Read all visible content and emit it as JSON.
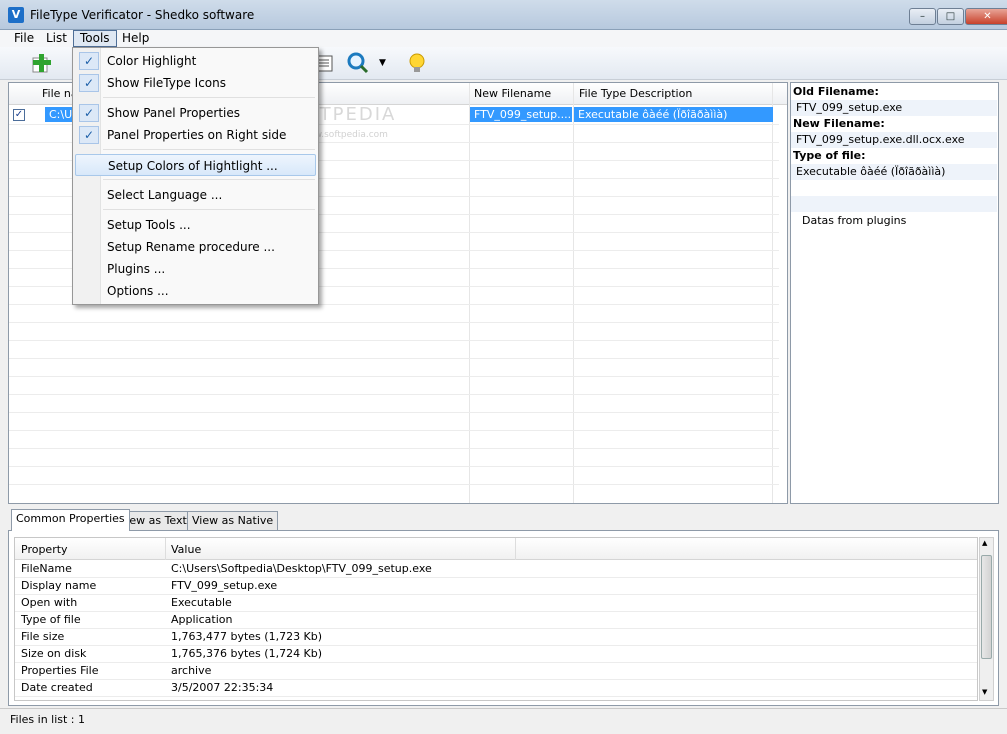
{
  "window": {
    "title": "FileType Verificator - Shedko software",
    "minimize": "–",
    "maximize": "□",
    "close": "✕"
  },
  "menu": [
    "File",
    "List",
    "Tools",
    "Help"
  ],
  "toolbar_icons": [
    "add-files-icon",
    "list-view-icon",
    "search-icon",
    "dropdown-arrow-icon",
    "lightbulb-icon"
  ],
  "grid": {
    "columns": [
      "File na",
      "New Filename",
      "File Type Description"
    ],
    "rows": [
      {
        "checked": true,
        "file": "C:\\Us",
        "new_filename": "FTV_099_setup....",
        "description": "Executable ôàéé (Ïðîãðàììà)"
      }
    ]
  },
  "watermark": {
    "text": "SOFTPEDIA",
    "sub": "www.softpedia.com"
  },
  "tools_menu": {
    "items": [
      {
        "label": "Color Highlight",
        "checked": true
      },
      {
        "label": "Show FileType Icons",
        "checked": true
      },
      {
        "label": "Show Panel Properties",
        "checked": true
      },
      {
        "label": "Panel Properties on Right side",
        "checked": true
      },
      {
        "label": "Setup Colors of Hightlight ...",
        "checked": false
      },
      {
        "label": "Select Language ...",
        "checked": false
      },
      {
        "label": "Setup Tools ...",
        "checked": false
      },
      {
        "label": "Setup Rename procedure ...",
        "checked": false
      },
      {
        "label": "Plugins ...",
        "checked": false
      },
      {
        "label": "Options ...",
        "checked": false
      }
    ],
    "check_glyph": "✓"
  },
  "right_panel": {
    "old_label": "Old Filename:",
    "old_value": "FTV_099_setup.exe",
    "new_label": "New Filename:",
    "new_value": "FTV_099_setup.exe.dll.ocx.exe",
    "type_label": "Type of file:",
    "type_value": "Executable ôàéé (Ïðîãðàììà)",
    "plugins_label": "Datas from plugins"
  },
  "tabs": [
    "Common Properties",
    "View as Text",
    "View as Native"
  ],
  "properties": {
    "headers": [
      "Property",
      "Value"
    ],
    "rows": [
      [
        "FileName",
        "C:\\Users\\Softpedia\\Desktop\\FTV_099_setup.exe"
      ],
      [
        "Display name",
        "FTV_099_setup.exe"
      ],
      [
        "Open with",
        "Executable"
      ],
      [
        "Type of file",
        "Application"
      ],
      [
        "File size",
        "1,763,477 bytes (1,723 Kb)"
      ],
      [
        "Size on disk",
        "1,765,376 bytes (1,724 Kb)"
      ],
      [
        "Properties File",
        "archive"
      ],
      [
        "Date created",
        "3/5/2007 22:35:34"
      ]
    ]
  },
  "status": {
    "text": "Files in list : 1"
  }
}
